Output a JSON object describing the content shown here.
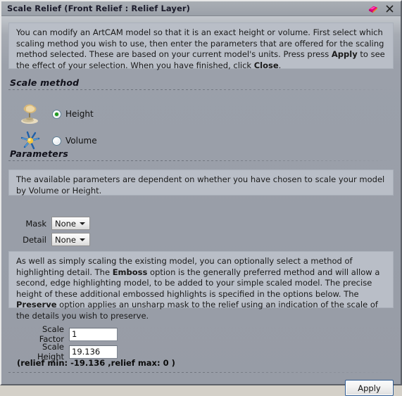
{
  "window": {
    "title": "Scale Relief (Front Relief : Relief Layer)",
    "relief_icon": "relief-layer-icon",
    "close_icon": "close-icon"
  },
  "intro": {
    "part1": "You can modify an ArtCAM model so that it is an exact height or volume. First select which scaling method you wish to use, then enter the parameters that are offered for the scaling method selected. These are based on your current model's units. Press press ",
    "bold1": "Apply",
    "part2": " to see the effect of your selection. When you have finished, click ",
    "bold2": "Close",
    "part3": "."
  },
  "scale_method": {
    "header": "Scale method",
    "options": [
      {
        "label": "Height",
        "icon": "height-relief-icon",
        "selected": true
      },
      {
        "label": "Volume",
        "icon": "volume-burst-icon",
        "selected": false
      }
    ]
  },
  "parameters": {
    "header": "Parameters",
    "info": "The available parameters are dependent on whether you have chosen to scale your model by Volume or Height.",
    "mask": {
      "label": "Mask",
      "value": "None",
      "options": [
        "None"
      ]
    },
    "detail": {
      "label": "Detail",
      "value": "None",
      "options": [
        "None"
      ]
    },
    "detail_info": {
      "part1": "As well as simply scaling the existing model, you can optionally select a method of highlighting detail. The ",
      "bold1": "Emboss",
      "part2": " option is the generally preferred method and will allow a second, edge highlighting model, to be added to your simple scaled model. The precise height of these additional embossed highlights is specified in the options below. The ",
      "bold2": "Preserve",
      "part3": " option applies an unsharp mask to the relief using an indication of the scale of the details you wish to preserve."
    },
    "scale_factor": {
      "label": "Scale Factor",
      "value": "1",
      "placeholder": ""
    },
    "scale_height": {
      "label": "Scale Height",
      "value": "19.136",
      "placeholder": ""
    },
    "relief_range": "(relief min: -19.136 ,relief max: 0 )"
  },
  "footer": {
    "apply_label": "Apply"
  },
  "colors": {
    "window_background": "#9aa0aa",
    "panel_background": "#b9bec7",
    "titlebar": "#a4a9b0",
    "radio_selected": "#1e9b1e",
    "focus_border": "#2f5c94",
    "text": "#111111"
  }
}
